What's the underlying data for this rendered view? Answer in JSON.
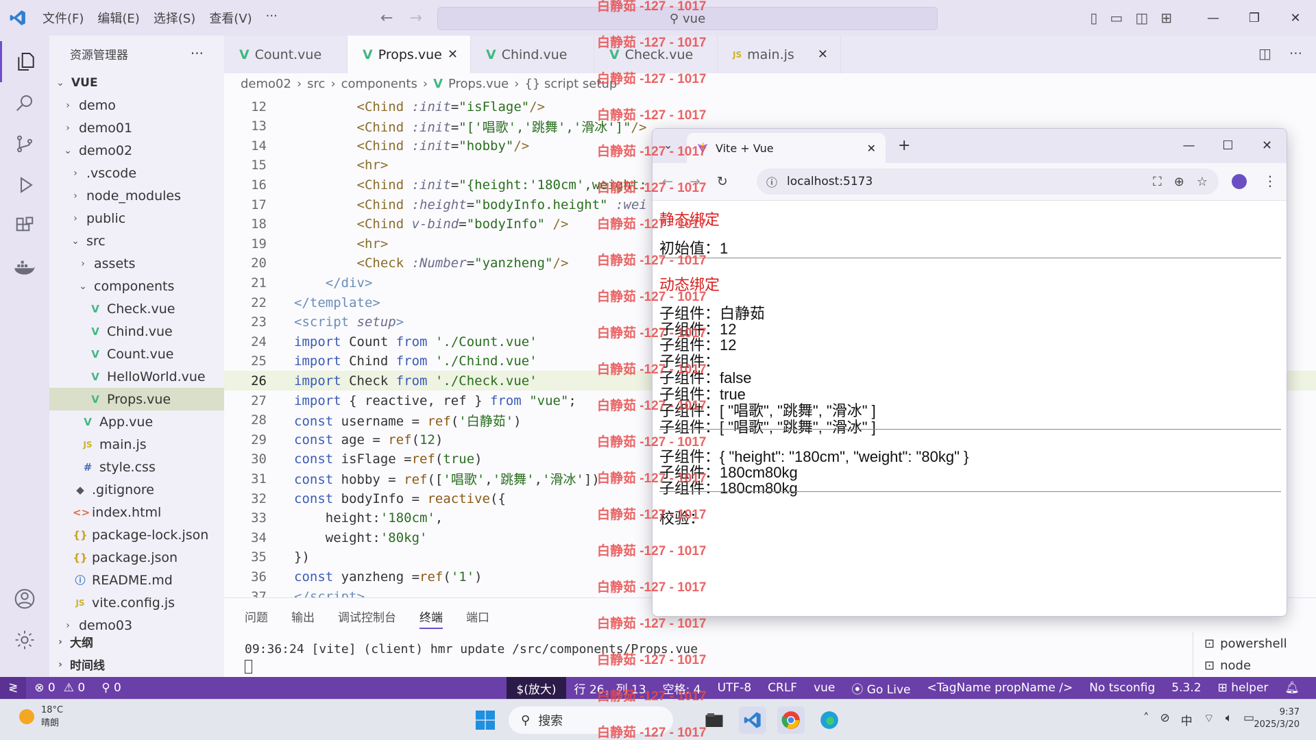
{
  "titlebar": {
    "menus": [
      "文件(F)",
      "编辑(E)",
      "选择(S)",
      "查看(V)",
      "···"
    ],
    "command_center": "vue"
  },
  "sidebar": {
    "title": "资源管理器",
    "more": "···",
    "tree": [
      {
        "label": "VUE",
        "kind": "root",
        "depth": 0,
        "chevron": "⌄",
        "bold": true
      },
      {
        "label": "demo",
        "kind": "folder",
        "depth": 1,
        "chevron": "›"
      },
      {
        "label": "demo01",
        "kind": "folder",
        "depth": 1,
        "chevron": "›"
      },
      {
        "label": "demo02",
        "kind": "folder",
        "depth": 1,
        "chevron": "⌄"
      },
      {
        "label": ".vscode",
        "kind": "folder",
        "depth": 2,
        "chevron": "›"
      },
      {
        "label": "node_modules",
        "kind": "folder",
        "depth": 2,
        "chevron": "›"
      },
      {
        "label": "public",
        "kind": "folder",
        "depth": 2,
        "chevron": "›"
      },
      {
        "label": "src",
        "kind": "folder",
        "depth": 2,
        "chevron": "⌄"
      },
      {
        "label": "assets",
        "kind": "folder",
        "depth": 3,
        "chevron": "›"
      },
      {
        "label": "components",
        "kind": "folder",
        "depth": 3,
        "chevron": "⌄"
      },
      {
        "label": "Check.vue",
        "kind": "vue",
        "depth": 4
      },
      {
        "label": "Chind.vue",
        "kind": "vue",
        "depth": 4
      },
      {
        "label": "Count.vue",
        "kind": "vue",
        "depth": 4
      },
      {
        "label": "HelloWorld.vue",
        "kind": "vue",
        "depth": 4
      },
      {
        "label": "Props.vue",
        "kind": "vue",
        "depth": 4,
        "selected": true
      },
      {
        "label": "App.vue",
        "kind": "vue",
        "depth": 3
      },
      {
        "label": "main.js",
        "kind": "js",
        "depth": 3
      },
      {
        "label": "style.css",
        "kind": "css",
        "depth": 3
      },
      {
        "label": ".gitignore",
        "kind": "git",
        "depth": 2
      },
      {
        "label": "index.html",
        "kind": "html",
        "depth": 2
      },
      {
        "label": "package-lock.json",
        "kind": "json",
        "depth": 2
      },
      {
        "label": "package.json",
        "kind": "json",
        "depth": 2
      },
      {
        "label": "README.md",
        "kind": "info",
        "depth": 2
      },
      {
        "label": "vite.config.js",
        "kind": "js",
        "depth": 2
      },
      {
        "label": "demo03",
        "kind": "folder",
        "depth": 1,
        "chevron": "›"
      }
    ],
    "outline": "大纲",
    "timeline": "时间线"
  },
  "tabs": [
    {
      "label": "Count.vue",
      "icon": "vue",
      "active": false
    },
    {
      "label": "Props.vue",
      "icon": "vue",
      "active": true
    },
    {
      "label": "Chind.vue",
      "icon": "vue",
      "active": false
    },
    {
      "label": "Check.vue",
      "icon": "vue",
      "active": false
    },
    {
      "label": "main.js",
      "icon": "js",
      "active": false
    }
  ],
  "breadcrumb": [
    "demo02",
    "src",
    "components",
    "Props.vue",
    "{} script setup"
  ],
  "code": [
    {
      "n": "12",
      "html": "        <span class='tag'>&lt;Chind</span> <span class='attr'>:init</span>=<span class='str'>\"isFlage\"</span><span class='tag'>/&gt;</span>"
    },
    {
      "n": "13",
      "html": "        <span class='tag'>&lt;Chind</span> <span class='attr'>:init</span>=<span class='str'>\"['唱歌','跳舞','滑冰']\"</span><span class='tag'>/&gt;</span>"
    },
    {
      "n": "14",
      "html": "        <span class='tag'>&lt;Chind</span> <span class='attr'>:init</span>=<span class='str'>\"hobby\"</span><span class='tag'>/&gt;</span>"
    },
    {
      "n": "15",
      "html": "        <span class='tag'>&lt;hr&gt;</span>"
    },
    {
      "n": "16",
      "html": "        <span class='tag'>&lt;Chind</span> <span class='attr'>:init</span>=<span class='str'>\"{height:'180cm',weight:</span>"
    },
    {
      "n": "17",
      "html": "        <span class='tag'>&lt;Chind</span> <span class='attr'>:height</span>=<span class='str'>\"bodyInfo.height\"</span> <span class='attr'>:wei</span>"
    },
    {
      "n": "18",
      "html": "        <span class='tag'>&lt;Chind</span> <span class='attr'>v-bind</span>=<span class='str'>\"bodyInfo\"</span> <span class='tag'>/&gt;</span>"
    },
    {
      "n": "19",
      "html": "        <span class='tag'>&lt;hr&gt;</span>"
    },
    {
      "n": "20",
      "html": "        <span class='tag'>&lt;Check</span> <span class='attr'>:Number</span>=<span class='str'>\"yanzheng\"</span><span class='tag'>/&gt;</span>"
    },
    {
      "n": "21",
      "html": "    <span class='tmpl'>&lt;/div&gt;</span>"
    },
    {
      "n": "22",
      "html": "<span class='tmpl'>&lt;/template&gt;</span>"
    },
    {
      "n": "23",
      "html": "<span class='tmpl'>&lt;script</span> <span class='attr'>setup</span><span class='tmpl'>&gt;</span>"
    },
    {
      "n": "24",
      "html": "<span class='kw'>import</span> Count <span class='kw'>from</span> <span class='str'>'./Count.vue'</span>"
    },
    {
      "n": "25",
      "html": "<span class='kw'>import</span> Chind <span class='kw'>from</span> <span class='str'>'./Chind.vue'</span>"
    },
    {
      "n": "26",
      "html": "<span class='kw'>import</span> Check <span class='kw'>from</span> <span class='str'>'./Check.vue'</span>",
      "current": true
    },
    {
      "n": "27",
      "html": "<span class='kw'>import</span> { reactive, ref } <span class='kw'>from</span> <span class='str'>\"vue\"</span>;"
    },
    {
      "n": "28",
      "html": "<span class='kw'>const</span> username = <span class='fn'>ref</span>(<span class='str'>'白静茹'</span>)"
    },
    {
      "n": "29",
      "html": "<span class='kw'>const</span> age = <span class='fn'>ref</span>(<span class='str'>12</span>)"
    },
    {
      "n": "30",
      "html": "<span class='kw'>const</span> isFlage =<span class='fn'>ref</span>(<span class='str'>true</span>)"
    },
    {
      "n": "31",
      "html": "<span class='kw'>const</span> hobby = <span class='fn'>ref</span>([<span class='str'>'唱歌'</span>,<span class='str'>'跳舞'</span>,<span class='str'>'滑冰'</span>])"
    },
    {
      "n": "32",
      "html": "<span class='kw'>const</span> bodyInfo = <span class='fn'>reactive</span>({"
    },
    {
      "n": "33",
      "html": "    height:<span class='str'>'180cm'</span>,"
    },
    {
      "n": "34",
      "html": "    weight:<span class='str'>'80kg'</span>"
    },
    {
      "n": "35",
      "html": "})"
    },
    {
      "n": "36",
      "html": "<span class='kw'>const</span> yanzheng =<span class='fn'>ref</span>(<span class='str'>'1'</span>)"
    },
    {
      "n": "37",
      "html": "<span class='tmpl'>&lt;/script&gt;</span>"
    }
  ],
  "panel": {
    "tabs": [
      "问题",
      "输出",
      "调试控制台",
      "终端",
      "端口"
    ],
    "active_tab": "终端",
    "terminal_line": "09:36:24 [vite] (client) hmr update /src/components/Props.vue",
    "terminals": [
      "powershell",
      "node"
    ]
  },
  "statusbar": {
    "remote": "≷",
    "errors": "⊗ 0",
    "warnings": "⚠ 0",
    "ports": "⚲ 0",
    "zoom": "$(放大)",
    "position": "行 26，列 13",
    "spaces": "空格: 4",
    "encoding": "UTF-8",
    "eol": "CRLF",
    "language": "vue",
    "golive": "Go Live",
    "tagname": "<TagName propName />",
    "tsconfig": "No tsconfig",
    "version": "5.3.2",
    "helper": "helper"
  },
  "taskbar": {
    "temp": "18°C",
    "weather": "晴朗",
    "search": "搜索",
    "ime": "中",
    "time": "9:37",
    "date": "2025/3/20"
  },
  "browser": {
    "tab_title": "Vite + Vue",
    "url": "localhost:5173",
    "content": [
      {
        "text": "静态绑定",
        "red": true
      },
      {
        "text": "初始值：1"
      },
      {
        "text": "动态绑定",
        "red": true
      },
      {
        "text": "子组件：白静茹"
      },
      {
        "text": "子组件：12"
      },
      {
        "text": "子组件：12"
      },
      {
        "text": "子组件："
      },
      {
        "text": "子组件：false"
      },
      {
        "text": "子组件：true"
      },
      {
        "text": "子组件：[ \"唱歌\", \"跳舞\", \"滑冰\" ]"
      },
      {
        "text": "子组件：[ \"唱歌\", \"跳舞\", \"滑冰\" ]"
      },
      {
        "text": "子组件：{ \"height\": \"180cm\", \"weight\": \"80kg\" }"
      },
      {
        "text": "子组件：180cm80kg"
      },
      {
        "text": "子组件：180cm80kg"
      },
      {
        "text": "校验："
      }
    ]
  },
  "watermark": "白静茹 -127 - 1017",
  "colors": {
    "accent": "#6a3fa8",
    "vue": "#42b883",
    "red_text": "#d81e1e"
  }
}
